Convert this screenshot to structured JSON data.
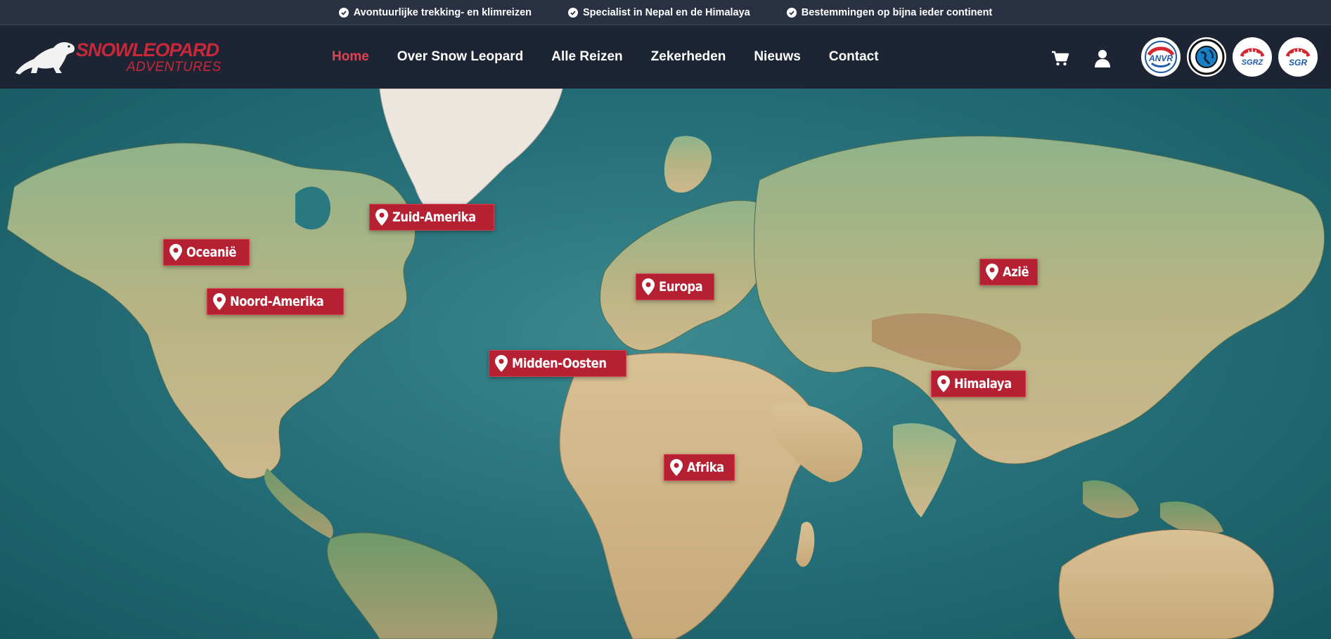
{
  "topbar": {
    "usps": [
      "Avontuurlijke trekking- en klimreizen",
      "Specialist in Nepal en de Himalaya",
      "Bestemmingen op bijna ieder continent"
    ]
  },
  "logo": {
    "main": "SNOWLEOPARD",
    "sub": "ADVENTURES"
  },
  "nav": {
    "items": [
      "Home",
      "Over Snow Leopard",
      "Alle Reizen",
      "Zekerheden",
      "Nieuws",
      "Contact"
    ],
    "active_index": 0
  },
  "header_icons": [
    "cart-icon",
    "user-icon"
  ],
  "badges": [
    {
      "text": "ANVR"
    },
    {
      "text": ""
    },
    {
      "text": "SGRZ"
    },
    {
      "text": "SGR"
    }
  ],
  "map": {
    "pins": [
      {
        "label": "Zuid-Amerika"
      },
      {
        "label": "Oceanië"
      },
      {
        "label": "Noord-Amerika"
      },
      {
        "label": "Europa"
      },
      {
        "label": "Azië"
      },
      {
        "label": "Midden-Oosten"
      },
      {
        "label": "Himalaya"
      },
      {
        "label": "Afrika"
      }
    ]
  },
  "colors": {
    "brand_red": "#c8283a",
    "nav_active": "#e0434f",
    "header_bg": "#1d2433",
    "topbar_bg": "#2a3142",
    "pin_bg": "#b52133",
    "ocean": "#27717a"
  }
}
